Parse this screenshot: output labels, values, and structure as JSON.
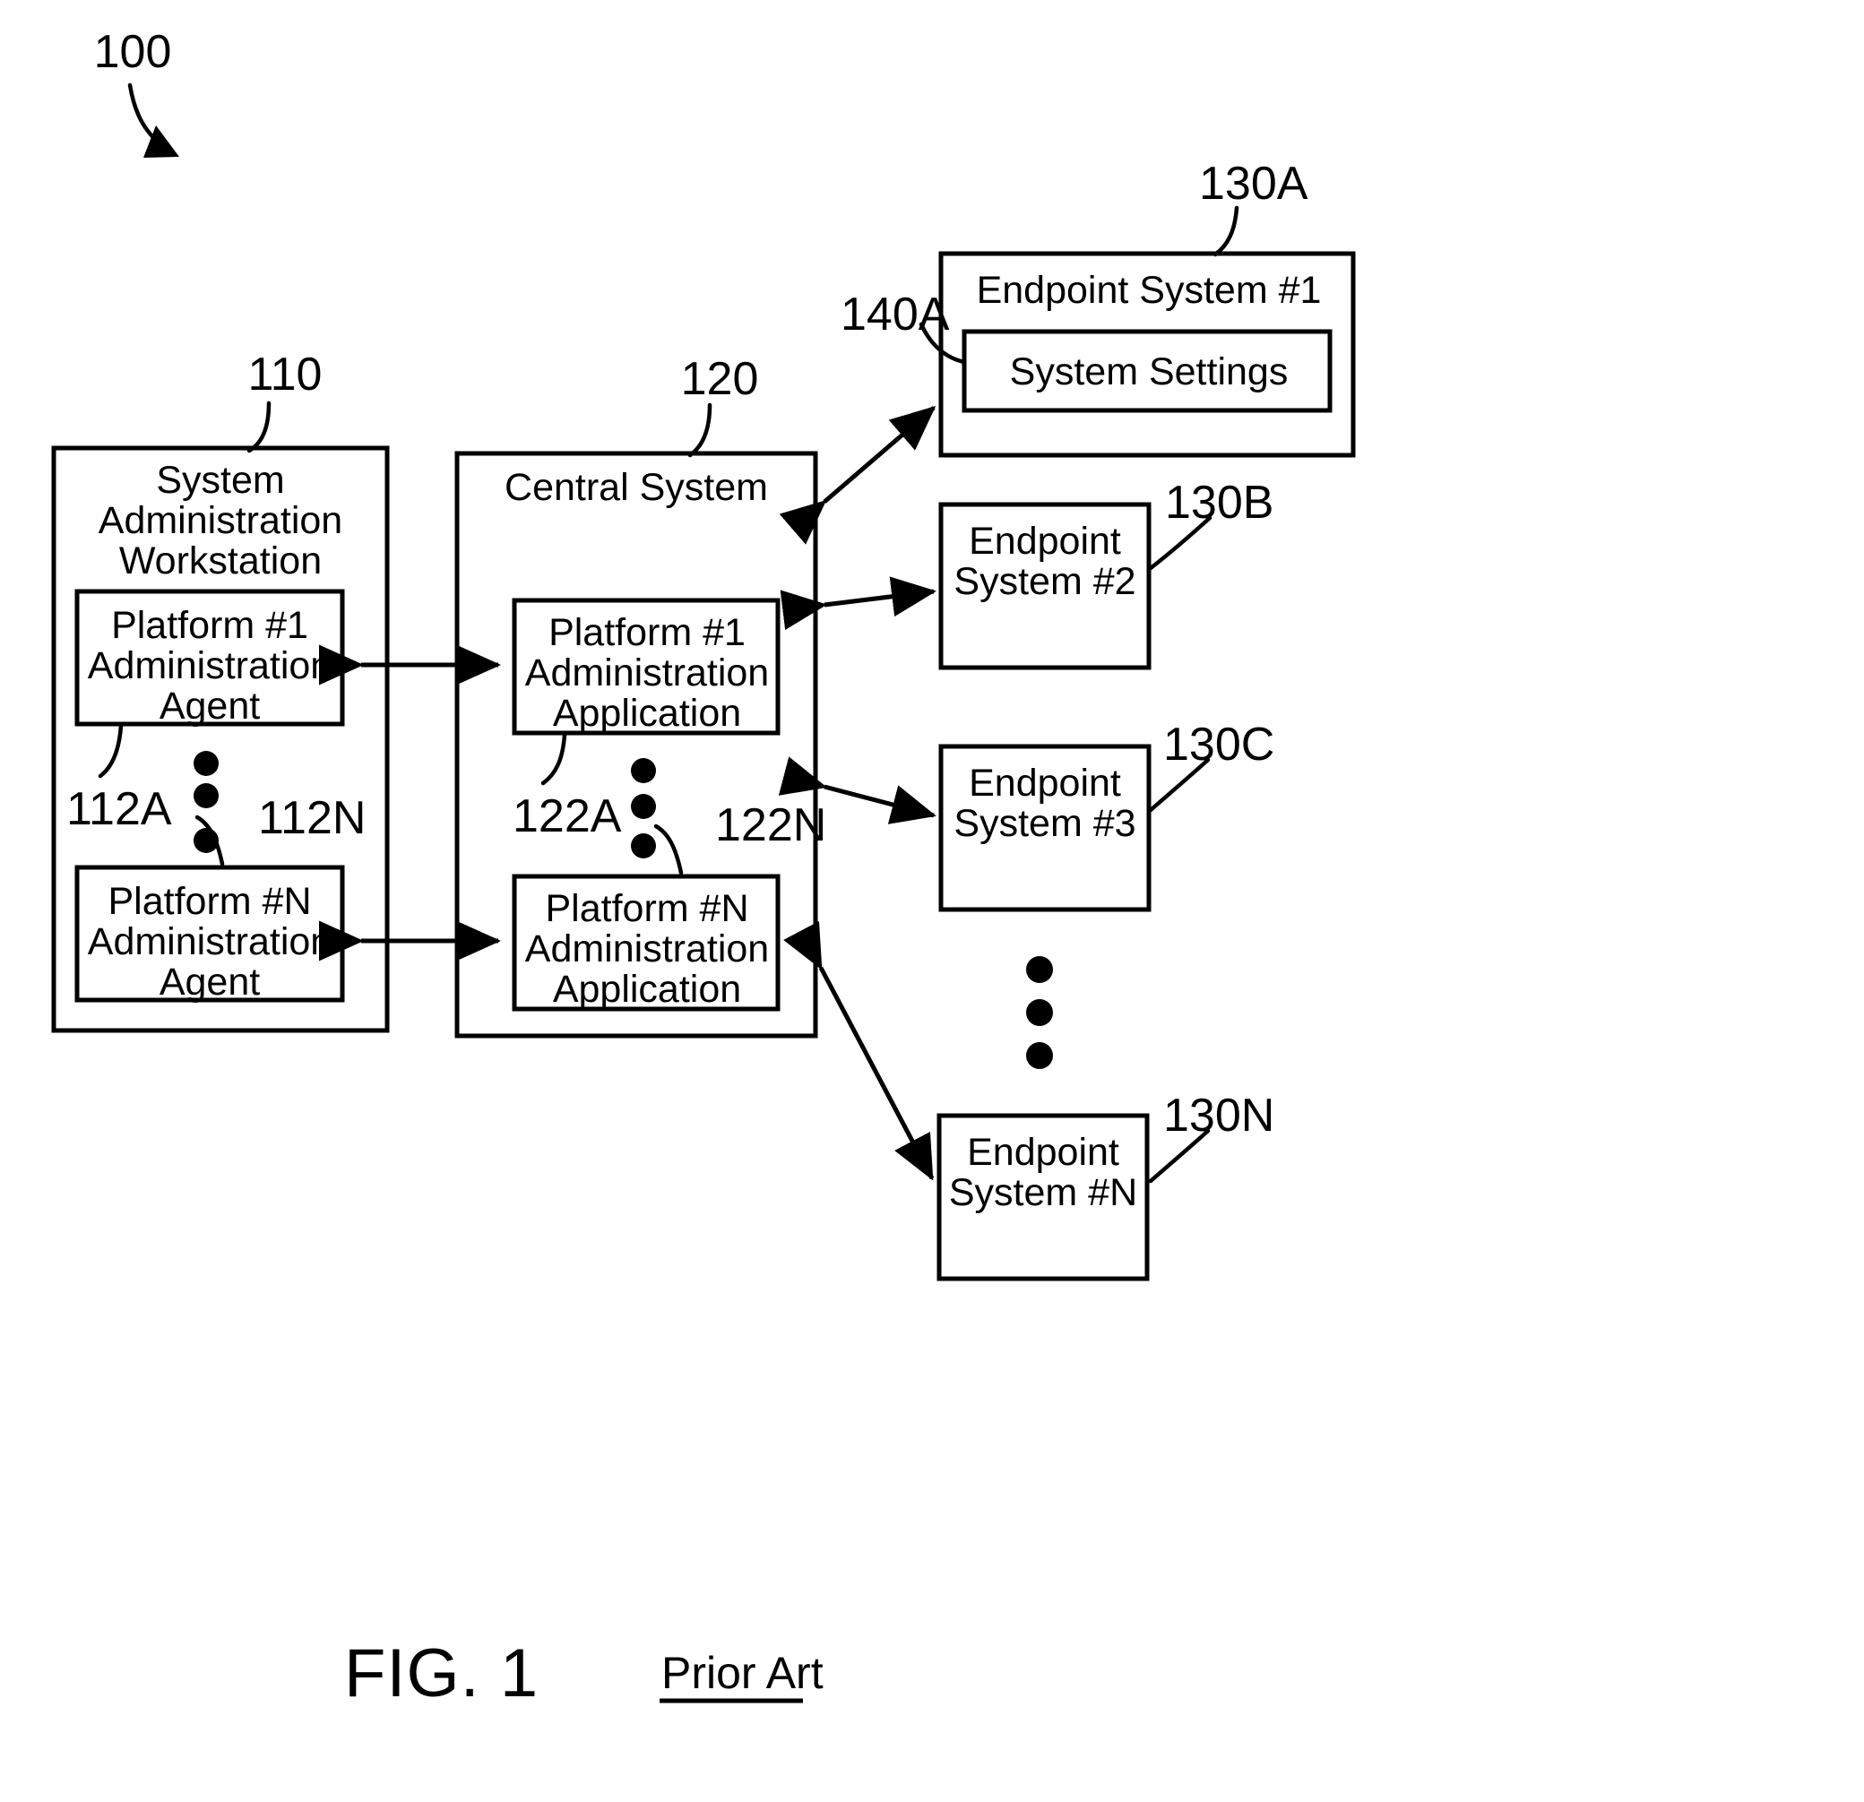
{
  "figure": {
    "number_label": "100",
    "caption": "FIG. 1",
    "annotation": "Prior Art"
  },
  "workstation": {
    "ref": "110",
    "title_lines": [
      "System",
      "Administration",
      "Workstation"
    ],
    "agents": [
      {
        "ref": "112A",
        "lines": [
          "Platform #1",
          "Administration",
          "Agent"
        ]
      },
      {
        "ref": "112N",
        "lines": [
          "Platform #N",
          "Administration",
          "Agent"
        ]
      }
    ]
  },
  "central_system": {
    "ref": "120",
    "title_lines": [
      "Central System"
    ],
    "applications": [
      {
        "ref": "122A",
        "lines": [
          "Platform #1",
          "Administration",
          "Application"
        ]
      },
      {
        "ref": "122N",
        "lines": [
          "Platform #N",
          "Administration",
          "Application"
        ]
      }
    ]
  },
  "endpoints": [
    {
      "ref": "130A",
      "lines": [
        "Endpoint System #1"
      ],
      "inner": {
        "ref": "140A",
        "label": "System Settings"
      }
    },
    {
      "ref": "130B",
      "lines": [
        "Endpoint",
        "System #2"
      ]
    },
    {
      "ref": "130C",
      "lines": [
        "Endpoint",
        "System #3"
      ]
    },
    {
      "ref": "130N",
      "lines": [
        "Endpoint",
        "System #N"
      ]
    }
  ],
  "colors": {
    "ink": "#000000",
    "paper": "#ffffff"
  }
}
